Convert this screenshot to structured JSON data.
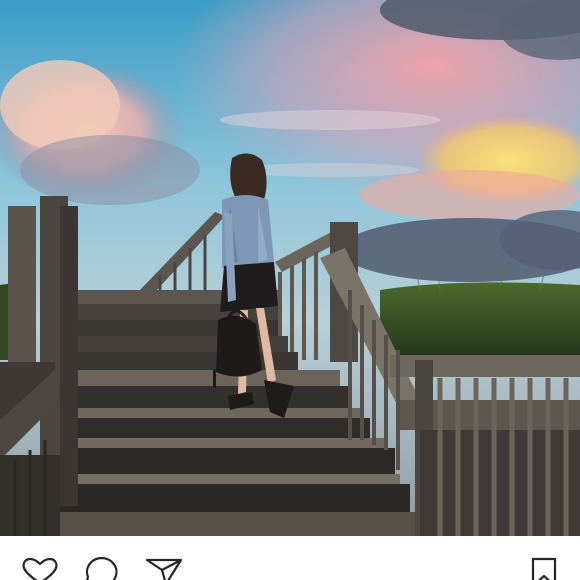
{
  "post": {
    "image": {
      "subject": "woman-on-boardwalk-stairs-at-sunset",
      "colors": {
        "sky_top": "#3f9ec4",
        "sky_mid": "#8fc3d6",
        "cloud_pink": "#f4a6a8",
        "cloud_yellow": "#f7d36a",
        "storm_cloud": "#4a5468",
        "grass": "#2e4a22",
        "wood_dark": "#3a3733",
        "wood_mid": "#5c564e",
        "wood_light": "#8a8276"
      }
    },
    "actions": {
      "like": {
        "icon": "heart-icon"
      },
      "comment": {
        "icon": "comment-icon"
      },
      "share": {
        "icon": "share-icon"
      },
      "save": {
        "icon": "bookmark-icon"
      }
    }
  }
}
